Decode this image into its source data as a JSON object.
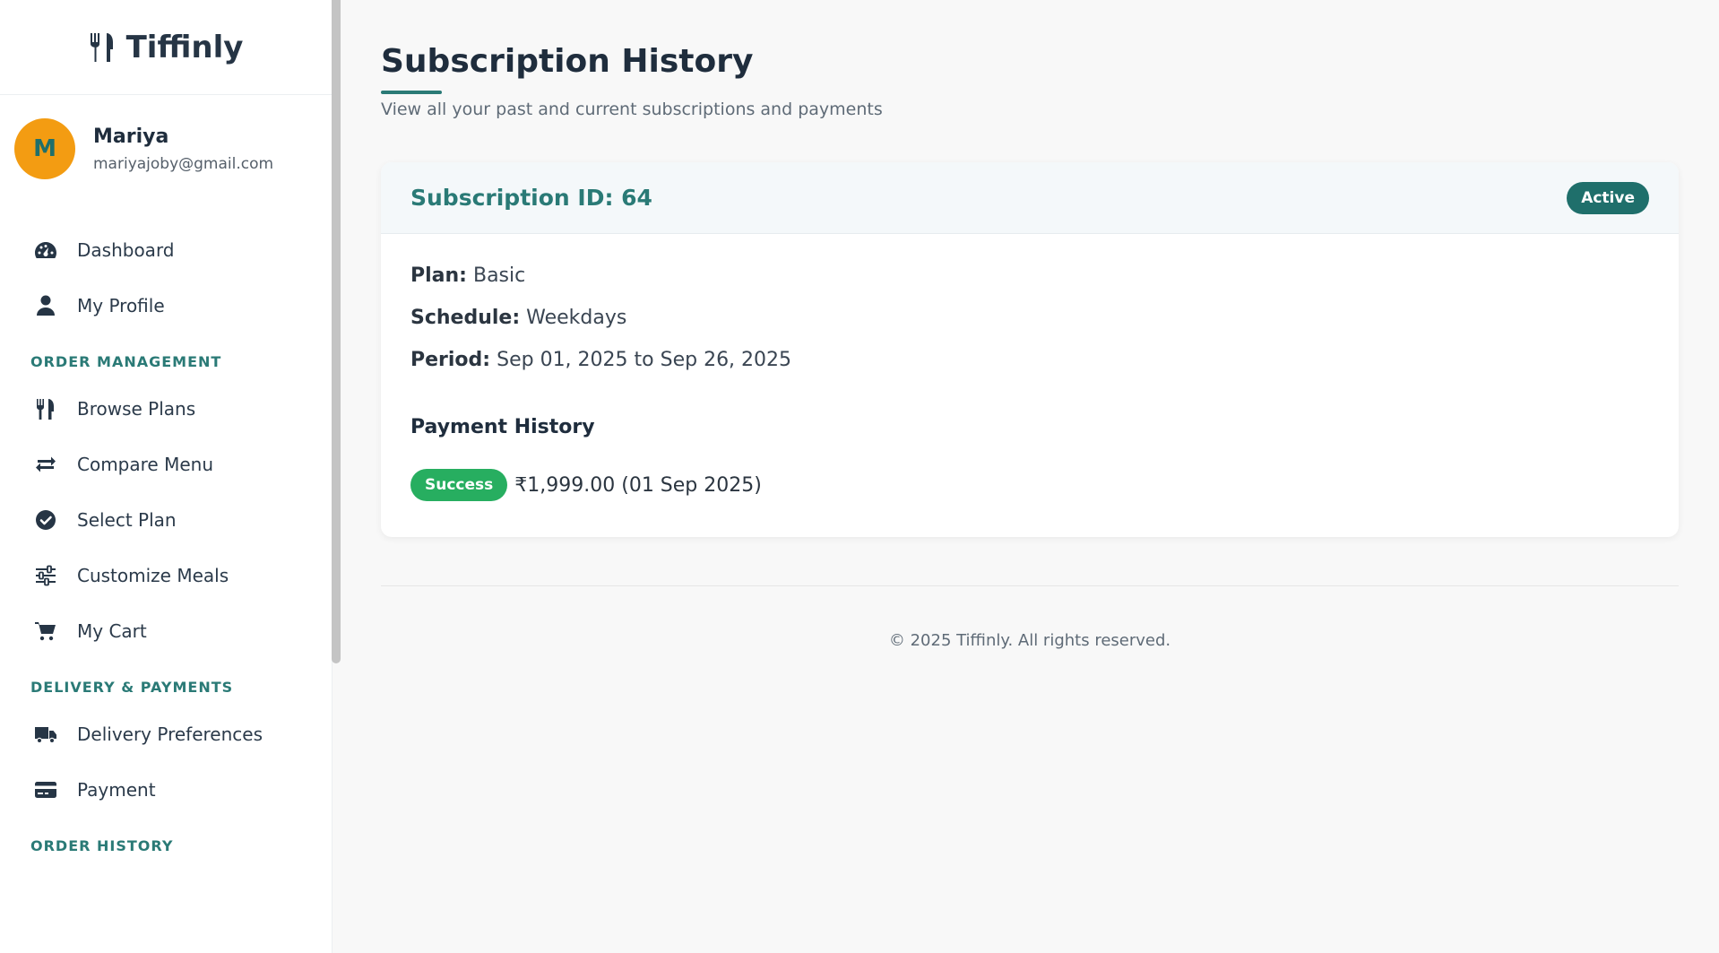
{
  "brand": {
    "name": "Tiffinly",
    "icon": "utensils-icon"
  },
  "user": {
    "initial": "M",
    "name": "Mariya",
    "email": "mariyajoby@gmail.com"
  },
  "sidebar": {
    "top_items": [
      {
        "label": "Dashboard",
        "icon": "dashboard-gauge-icon"
      },
      {
        "label": "My Profile",
        "icon": "user-icon"
      }
    ],
    "sections": [
      {
        "title": "ORDER MANAGEMENT",
        "items": [
          {
            "label": "Browse Plans",
            "icon": "utensils-icon"
          },
          {
            "label": "Compare Menu",
            "icon": "exchange-arrows-icon"
          },
          {
            "label": "Select Plan",
            "icon": "check-circle-icon"
          },
          {
            "label": "Customize Meals",
            "icon": "sliders-icon"
          },
          {
            "label": "My Cart",
            "icon": "cart-icon"
          }
        ]
      },
      {
        "title": "DELIVERY & PAYMENTS",
        "items": [
          {
            "label": "Delivery Preferences",
            "icon": "truck-icon"
          },
          {
            "label": "Payment",
            "icon": "credit-card-icon"
          }
        ]
      },
      {
        "title": "ORDER HISTORY",
        "items": []
      }
    ]
  },
  "page": {
    "title": "Subscription History",
    "subtitle": "View all your past and current subscriptions and payments"
  },
  "subscription": {
    "id_label": "Subscription ID: 64",
    "status": "Active",
    "plan_label": "Plan:",
    "plan_value": "Basic",
    "schedule_label": "Schedule:",
    "schedule_value": "Weekdays",
    "period_label": "Period:",
    "period_value": "Sep 01, 2025 to Sep 26, 2025",
    "payment_history_title": "Payment History",
    "payments": [
      {
        "status": "Success",
        "detail": "₹1,999.00 (01 Sep 2025)"
      }
    ]
  },
  "footer": {
    "text": "© 2025 Tiffinly. All rights reserved."
  },
  "colors": {
    "accent": "#2a7a76",
    "avatar": "#f39c12",
    "success": "#27ae60"
  }
}
